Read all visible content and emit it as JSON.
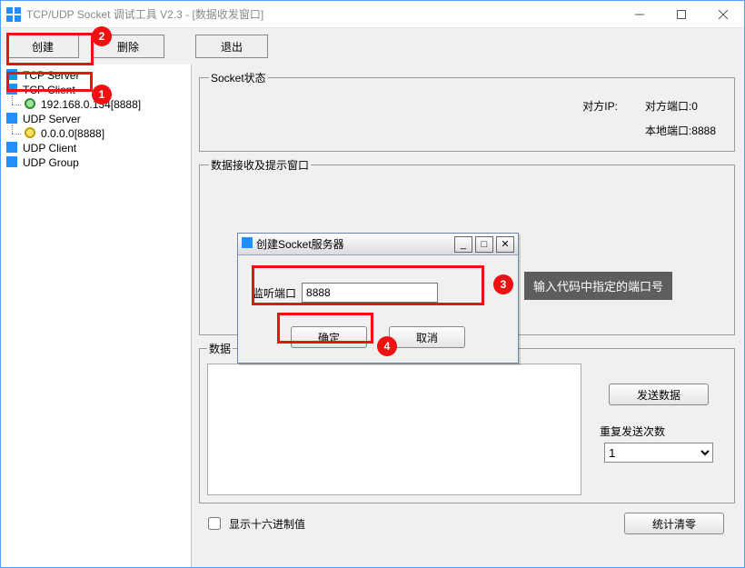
{
  "titlebar": {
    "title": "TCP/UDP Socket 调试工具 V2.3  - [数据收发窗口]"
  },
  "toolbar": {
    "create": "创建",
    "delete": "删除",
    "exit": "退出"
  },
  "sidebar": {
    "items": [
      {
        "label": "TCP Server",
        "type": "root"
      },
      {
        "label": "TCP Client",
        "type": "root"
      },
      {
        "label": "192.168.0.134[8888]",
        "type": "child",
        "dot": "green"
      },
      {
        "label": "UDP Server",
        "type": "root"
      },
      {
        "label": "0.0.0.0[8888]",
        "type": "child",
        "dot": "yellow"
      },
      {
        "label": "UDP Client",
        "type": "root"
      },
      {
        "label": "UDP Group",
        "type": "root"
      }
    ]
  },
  "status": {
    "legend": "Socket状态",
    "remote_ip_label": "对方IP:",
    "remote_ip_value": "",
    "remote_port_label": "对方端口:",
    "remote_port_value": "0",
    "local_port_label": "本地端口:",
    "local_port_value": "8888"
  },
  "recv": {
    "legend": "数据接收及提示窗口"
  },
  "send": {
    "legend": "数据发送窗口",
    "legend_short": "数据",
    "send_btn": "发送数据",
    "repeat_label": "重复发送次数",
    "repeat_value": "1"
  },
  "footer": {
    "hex_label": "显示十六进制值",
    "clear_btn": "统计清零"
  },
  "dialog": {
    "title": "创建Socket服务器",
    "port_label": "监听端口",
    "port_value": "8888",
    "ok": "确定",
    "cancel": "取消"
  },
  "annotations": {
    "1": "1",
    "2": "2",
    "3": "3",
    "4": "4",
    "tip3": "输入代码中指定的端口号"
  }
}
